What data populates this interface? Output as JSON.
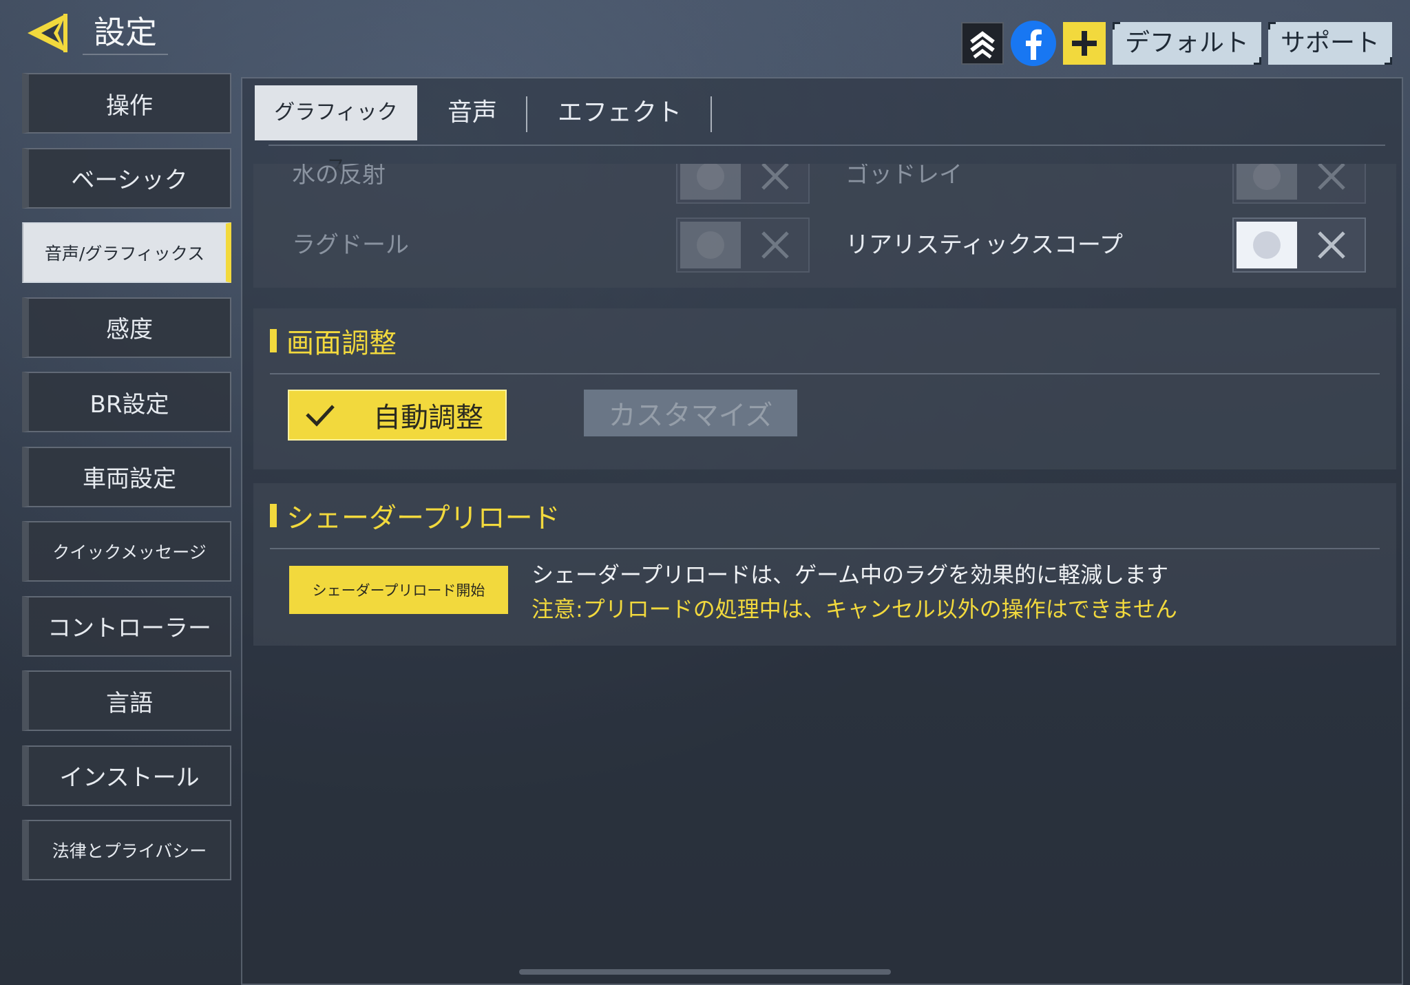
{
  "header": {
    "title": "設定",
    "buttons": {
      "default": "デフォルト",
      "support": "サポート"
    },
    "icons": [
      "back-arrow-icon",
      "rank-chevrons-icon",
      "facebook-icon",
      "plus-icon"
    ]
  },
  "sidebar": {
    "items": [
      {
        "label": "操作"
      },
      {
        "label": "ベーシック"
      },
      {
        "label": "音声/グラフィックス",
        "active": true
      },
      {
        "label": "感度"
      },
      {
        "label": "BR設定"
      },
      {
        "label": "車両設定"
      },
      {
        "label": "クイックメッセージ"
      },
      {
        "label": "コントローラー"
      },
      {
        "label": "言語"
      },
      {
        "label": "インストール"
      },
      {
        "label": "法律とプライバシー"
      }
    ]
  },
  "tabs": [
    {
      "label": "グラフィックス",
      "active": true
    },
    {
      "label": "音声"
    },
    {
      "label": "エフェクト"
    }
  ],
  "options": {
    "water_reflection": "水の反射",
    "god_rays": "ゴッドレイ",
    "ragdoll": "ラグドール",
    "realistic_scope": "リアリスティックスコープ"
  },
  "screen_adjust": {
    "title": "画面調整",
    "auto_label": "自動調整",
    "custom_label": "カスタマイズ"
  },
  "shader_preload": {
    "title": "シェーダープリロード",
    "button_label": "シェーダープリロード開始",
    "description": "シェーダープリロードは、ゲーム中のラグを効果的に軽減します",
    "warning": "注意:プリロードの処理中は、キャンセル以外の操作はできません"
  },
  "colors": {
    "accent": "#f2d93d",
    "panel": "#404856",
    "active_tab": "#dfe3e8"
  }
}
